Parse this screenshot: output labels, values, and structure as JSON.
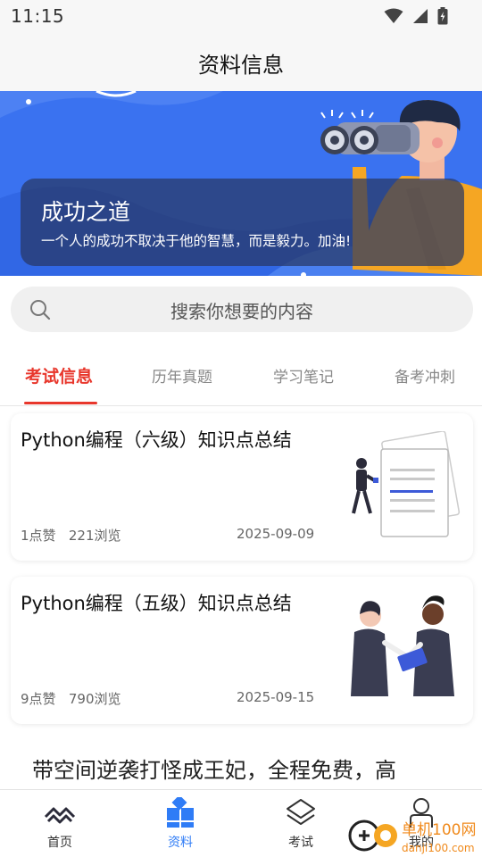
{
  "status_bar": {
    "time": "11:15"
  },
  "header": {
    "title": "资料信息"
  },
  "banner": {
    "title": "成功之道",
    "subtitle": "一个人的成功不取决于他的智慧，而是毅力。加油!"
  },
  "search": {
    "placeholder": "搜索你想要的内容"
  },
  "tabs": [
    {
      "label": "考试信息",
      "active": true
    },
    {
      "label": "历年真题",
      "active": false
    },
    {
      "label": "学习笔记",
      "active": false
    },
    {
      "label": "备考冲刺",
      "active": false
    }
  ],
  "articles": [
    {
      "title": "Python编程（六级）知识点总结",
      "likes": "1点赞",
      "views": "221浏览",
      "date": "2025-09-09"
    },
    {
      "title": "Python编程（五级）知识点总结",
      "likes": "9点赞",
      "views": "790浏览",
      "date": "2025-09-15"
    }
  ],
  "feature_article": {
    "title": "带空间逆袭打怪成王妃，全程免费，高"
  },
  "bottom_nav": [
    {
      "label": "首页",
      "icon": "mountain-icon",
      "active": false
    },
    {
      "label": "资料",
      "icon": "grid-icon",
      "active": true
    },
    {
      "label": "考试",
      "icon": "layers-icon",
      "active": false
    },
    {
      "label": "我的",
      "icon": "user-icon",
      "active": false
    }
  ],
  "watermark": {
    "text": "单机100网",
    "url_text": "danji100.com"
  },
  "colors": {
    "accent": "#e8372c",
    "nav_active": "#2f7cf6",
    "banner_bg": "#3a72f0"
  }
}
